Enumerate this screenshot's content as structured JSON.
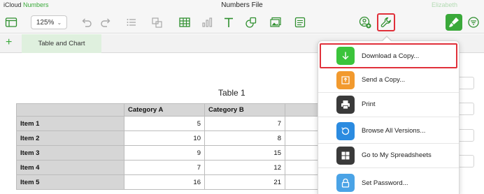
{
  "titlebar": {
    "brand_prefix": "iCloud",
    "brand_app": "Numbers",
    "document_title": "Numbers File",
    "user_name": "Elizabeth"
  },
  "toolbar": {
    "zoom": "125%"
  },
  "sheets": {
    "add_label": "+",
    "tabs": [
      {
        "label": "Table and Chart"
      }
    ]
  },
  "table": {
    "title": "Table 1",
    "columns": [
      "",
      "Category A",
      "Category B",
      ""
    ],
    "rows": [
      {
        "label": "Item 1",
        "a": "5",
        "b": "7"
      },
      {
        "label": "Item 2",
        "a": "10",
        "b": "8"
      },
      {
        "label": "Item 3",
        "a": "9",
        "b": "15"
      },
      {
        "label": "Item 4",
        "a": "7",
        "b": "12"
      },
      {
        "label": "Item 5",
        "a": "16",
        "b": "21"
      }
    ]
  },
  "menu": {
    "items": [
      {
        "label": "Download a Copy...",
        "icon": "download-icon",
        "color": "#3bc43b"
      },
      {
        "label": "Send a Copy...",
        "icon": "send-icon",
        "color": "#f29a2e"
      },
      {
        "label": "Print",
        "icon": "print-icon",
        "color": "#3a3a3a"
      },
      {
        "label": "Browse All Versions...",
        "icon": "versions-icon",
        "color": "#2b8be0"
      },
      {
        "label": "Go to My Spreadsheets",
        "icon": "grid-icon",
        "color": "#3a3a3a"
      },
      {
        "label": "Set Password...",
        "icon": "lock-icon",
        "color": "#4aa3e6"
      }
    ]
  },
  "colors": {
    "accent": "#3aa93a",
    "highlight": "#e0303a"
  }
}
